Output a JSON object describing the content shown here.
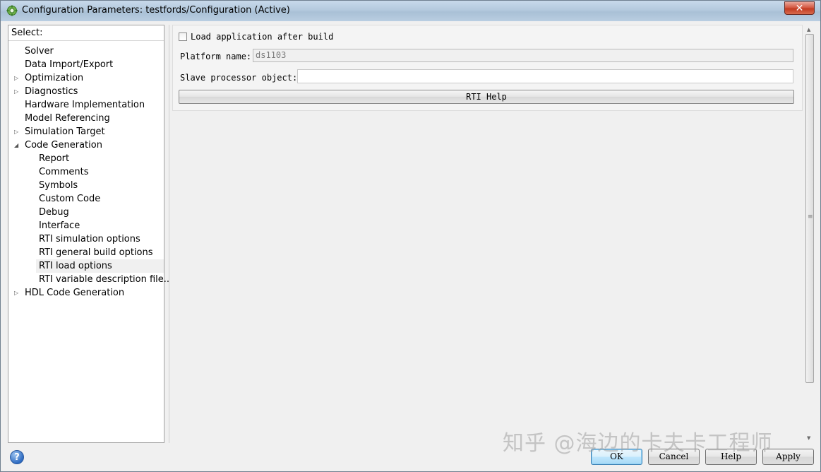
{
  "window": {
    "title": "Configuration Parameters: testfords/Configuration (Active)",
    "close_label": "✕"
  },
  "tree": {
    "header": "Select:",
    "items": [
      {
        "label": "Solver",
        "level": 0,
        "expander": "none",
        "selected": false
      },
      {
        "label": "Data Import/Export",
        "level": 0,
        "expander": "none",
        "selected": false
      },
      {
        "label": "Optimization",
        "level": 0,
        "expander": "collapsed",
        "selected": false
      },
      {
        "label": "Diagnostics",
        "level": 0,
        "expander": "collapsed",
        "selected": false
      },
      {
        "label": "Hardware Implementation",
        "level": 0,
        "expander": "none",
        "selected": false
      },
      {
        "label": "Model Referencing",
        "level": 0,
        "expander": "none",
        "selected": false
      },
      {
        "label": "Simulation Target",
        "level": 0,
        "expander": "collapsed",
        "selected": false
      },
      {
        "label": "Code Generation",
        "level": 0,
        "expander": "expanded",
        "selected": false
      },
      {
        "label": "Report",
        "level": 1,
        "expander": "none",
        "selected": false
      },
      {
        "label": "Comments",
        "level": 1,
        "expander": "none",
        "selected": false
      },
      {
        "label": "Symbols",
        "level": 1,
        "expander": "none",
        "selected": false
      },
      {
        "label": "Custom Code",
        "level": 1,
        "expander": "none",
        "selected": false
      },
      {
        "label": "Debug",
        "level": 1,
        "expander": "none",
        "selected": false
      },
      {
        "label": "Interface",
        "level": 1,
        "expander": "none",
        "selected": false
      },
      {
        "label": "RTI simulation options",
        "level": 1,
        "expander": "none",
        "selected": false
      },
      {
        "label": "RTI general build options",
        "level": 1,
        "expander": "none",
        "selected": false
      },
      {
        "label": "RTI load options",
        "level": 1,
        "expander": "none",
        "selected": true
      },
      {
        "label": "RTI variable description file...",
        "level": 1,
        "expander": "none",
        "selected": false
      },
      {
        "label": "HDL Code Generation",
        "level": 0,
        "expander": "collapsed",
        "selected": false
      }
    ]
  },
  "load_options": {
    "load_app_label": "Load application after build",
    "load_app_checked": false,
    "platform_label": "Platform name:",
    "platform_value": "ds1103",
    "slave_label": "Slave processor object:",
    "slave_value": "",
    "rti_help_label": "RTI Help"
  },
  "buttons": {
    "ok": "OK",
    "cancel": "Cancel",
    "help": "Help",
    "apply": "Apply"
  },
  "help_icon_glyph": "?",
  "watermark": "知乎 @海边的卡夫卡工程师",
  "colors": {
    "titlebar": "#b4c9de",
    "close_button": "#c23b22",
    "selected_item": "#f0f0f0"
  }
}
